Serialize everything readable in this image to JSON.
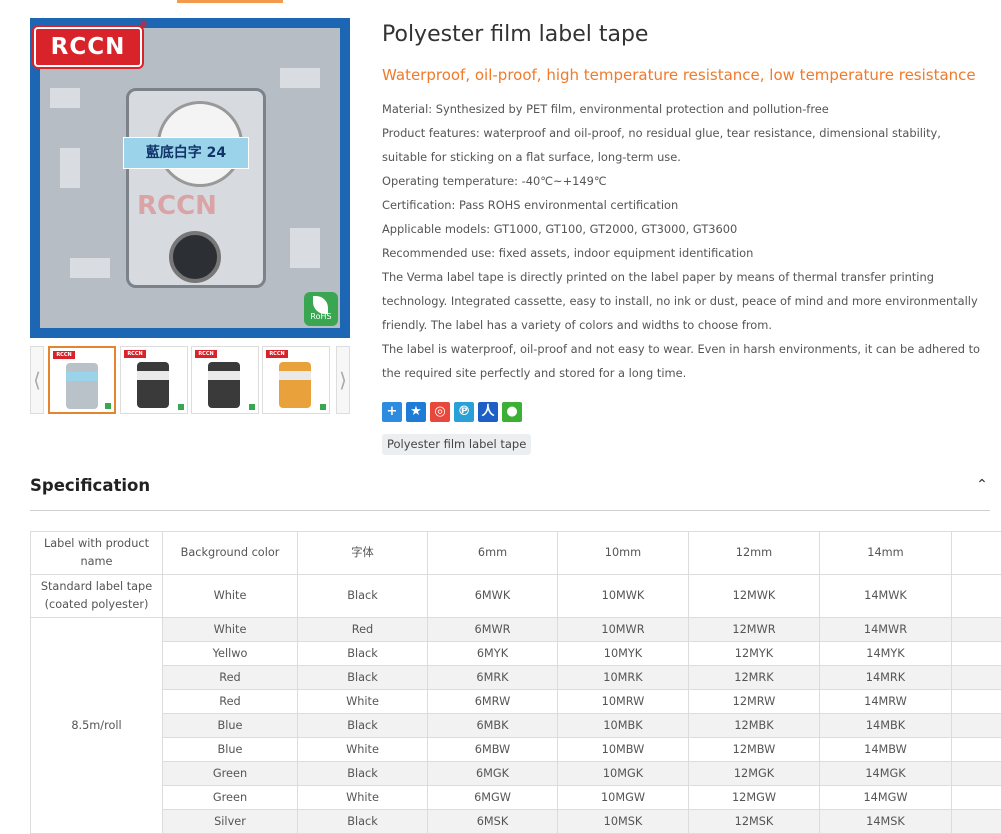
{
  "gallery": {
    "logo_text": "RCCN",
    "registered": "®",
    "tape_label": "藍底白字 24",
    "rohs": "RoHS",
    "prev_arrow": "⟨",
    "next_arrow": "⟩",
    "thumb_logo": "RCCN"
  },
  "product": {
    "title": "Polyester film label tape",
    "subtitle": "Waterproof, oil-proof, high temperature resistance, low temperature resistance",
    "description": [
      "Material: Synthesized by PET film, environmental protection and pollution-free",
      "Product features: waterproof and oil-proof, no residual glue, tear resistance, dimensional stability, suitable for sticking on a flat surface, long-term use.",
      "Operating temperature: -40℃~+149℃",
      "Certification: Pass ROHS environmental certification",
      "Applicable models: GT1000, GT100, GT2000, GT3000, GT3600",
      "Recommended use: fixed assets, indoor equipment identification",
      "The Verma label tape is directly printed on the label paper by means of thermal transfer printing technology. Integrated cassette, easy to install, no ink or dust, peace of mind and more environmentally friendly. The label has a variety of colors and widths to choose from.",
      "The label is waterproof, oil-proof and not easy to wear. Even in harsh environments, it can be adhered to the required site perfectly and stored for a long time."
    ],
    "share_icons": [
      "share-plus-icon",
      "qzone-star-icon",
      "weibo-icon",
      "tencent-weibo-icon",
      "renren-icon",
      "wechat-icon"
    ],
    "tag": "Polyester film label tape"
  },
  "spec": {
    "title": "Specification",
    "collapse_glyph": "⌃",
    "headers": [
      "Label with product name",
      "Background color",
      "字体",
      "6mm",
      "10mm",
      "12mm",
      "14mm",
      ""
    ],
    "standard_label": "Standard label tape (coated polyester)",
    "roll_label": "8.5m/roll",
    "standard_row": [
      "White",
      "Black",
      "6MWK",
      "10MWK",
      "12MWK",
      "14MWK",
      ""
    ],
    "rows": [
      [
        "White",
        "Red",
        "6MWR",
        "10MWR",
        "12MWR",
        "14MWR",
        ""
      ],
      [
        "Yellwo",
        "Black",
        "6MYK",
        "10MYK",
        "12MYK",
        "14MYK",
        ""
      ],
      [
        "Red",
        "Black",
        "6MRK",
        "10MRK",
        "12MRK",
        "14MRK",
        ""
      ],
      [
        "Red",
        "White",
        "6MRW",
        "10MRW",
        "12MRW",
        "14MRW",
        ""
      ],
      [
        "Blue",
        "Black",
        "6MBK",
        "10MBK",
        "12MBK",
        "14MBK",
        ""
      ],
      [
        "Blue",
        "White",
        "6MBW",
        "10MBW",
        "12MBW",
        "14MBW",
        ""
      ],
      [
        "Green",
        "Black",
        "6MGK",
        "10MGK",
        "12MGK",
        "14MGK",
        ""
      ],
      [
        "Green",
        "White",
        "6MGW",
        "10MGW",
        "12MGW",
        "14MGW",
        ""
      ],
      [
        "Silver",
        "Black",
        "6MSK",
        "10MSK",
        "12MSK",
        "14MSK",
        ""
      ]
    ]
  },
  "colors": {
    "accent": "#f07a2a",
    "brand_red": "#d8232a",
    "frame_blue": "#1c66b4",
    "rohs_green": "#3aa652"
  }
}
